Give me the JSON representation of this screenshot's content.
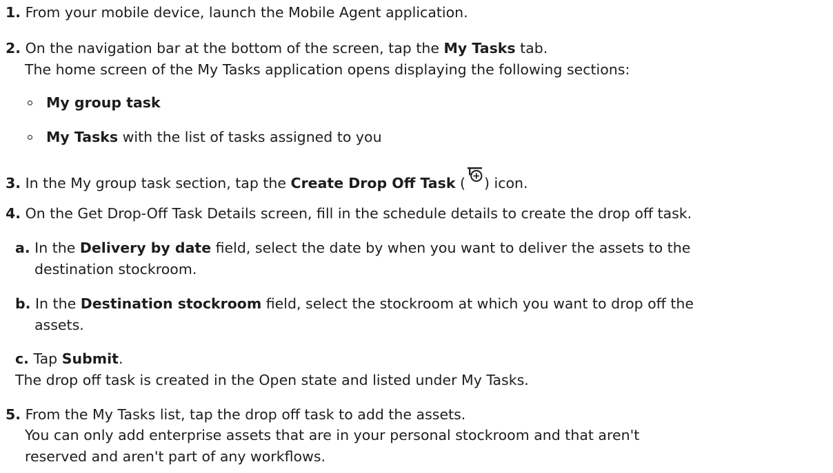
{
  "steps": {
    "s1": {
      "num": "1.",
      "text": "From your mobile device, launch the Mobile Agent application."
    },
    "s2": {
      "num": "2.",
      "pre": "On the navigation bar at the bottom of the screen, tap the ",
      "bold": "My Tasks",
      "post": " tab.",
      "result": "The home screen of the My Tasks application opens displaying the following sections:",
      "bullets": [
        {
          "bold": "My group task",
          "text": ""
        },
        {
          "bold": "My Tasks",
          "text": " with the list of tasks assigned to you"
        }
      ]
    },
    "s3": {
      "num": "3.",
      "pre": "In the My group task section, tap the ",
      "bold": "Create Drop Off Task",
      "open_paren": " (",
      "close_paren": ") icon."
    },
    "s4": {
      "num": "4.",
      "text": "On the Get Drop-Off Task Details screen, fill in the schedule details to create the drop off task.",
      "sub": {
        "a": {
          "num": "a.",
          "pre": "In the ",
          "bold": "Delivery by date",
          "post": " field, select the date by when you want to deliver the assets to the",
          "line2": "destination stockroom."
        },
        "b": {
          "num": "b.",
          "pre": "In the ",
          "bold": "Destination stockroom",
          "post": " field, select the stockroom at which you want to drop off the",
          "line2": "assets."
        },
        "c": {
          "num": "c.",
          "pre": "Tap ",
          "bold": "Submit",
          "post": ".",
          "result": "The drop off task is created in the Open state and listed under My Tasks."
        }
      }
    },
    "s5": {
      "num": "5.",
      "text": "From the My Tasks list, tap the drop off task to add the assets.",
      "result_line1": "You can only add enterprise assets that are in your personal stockroom and that aren't",
      "result_line2": "reserved and aren't part of any workflows."
    }
  },
  "icons": {
    "create_drop_off": "create-drop-off-task-icon"
  }
}
